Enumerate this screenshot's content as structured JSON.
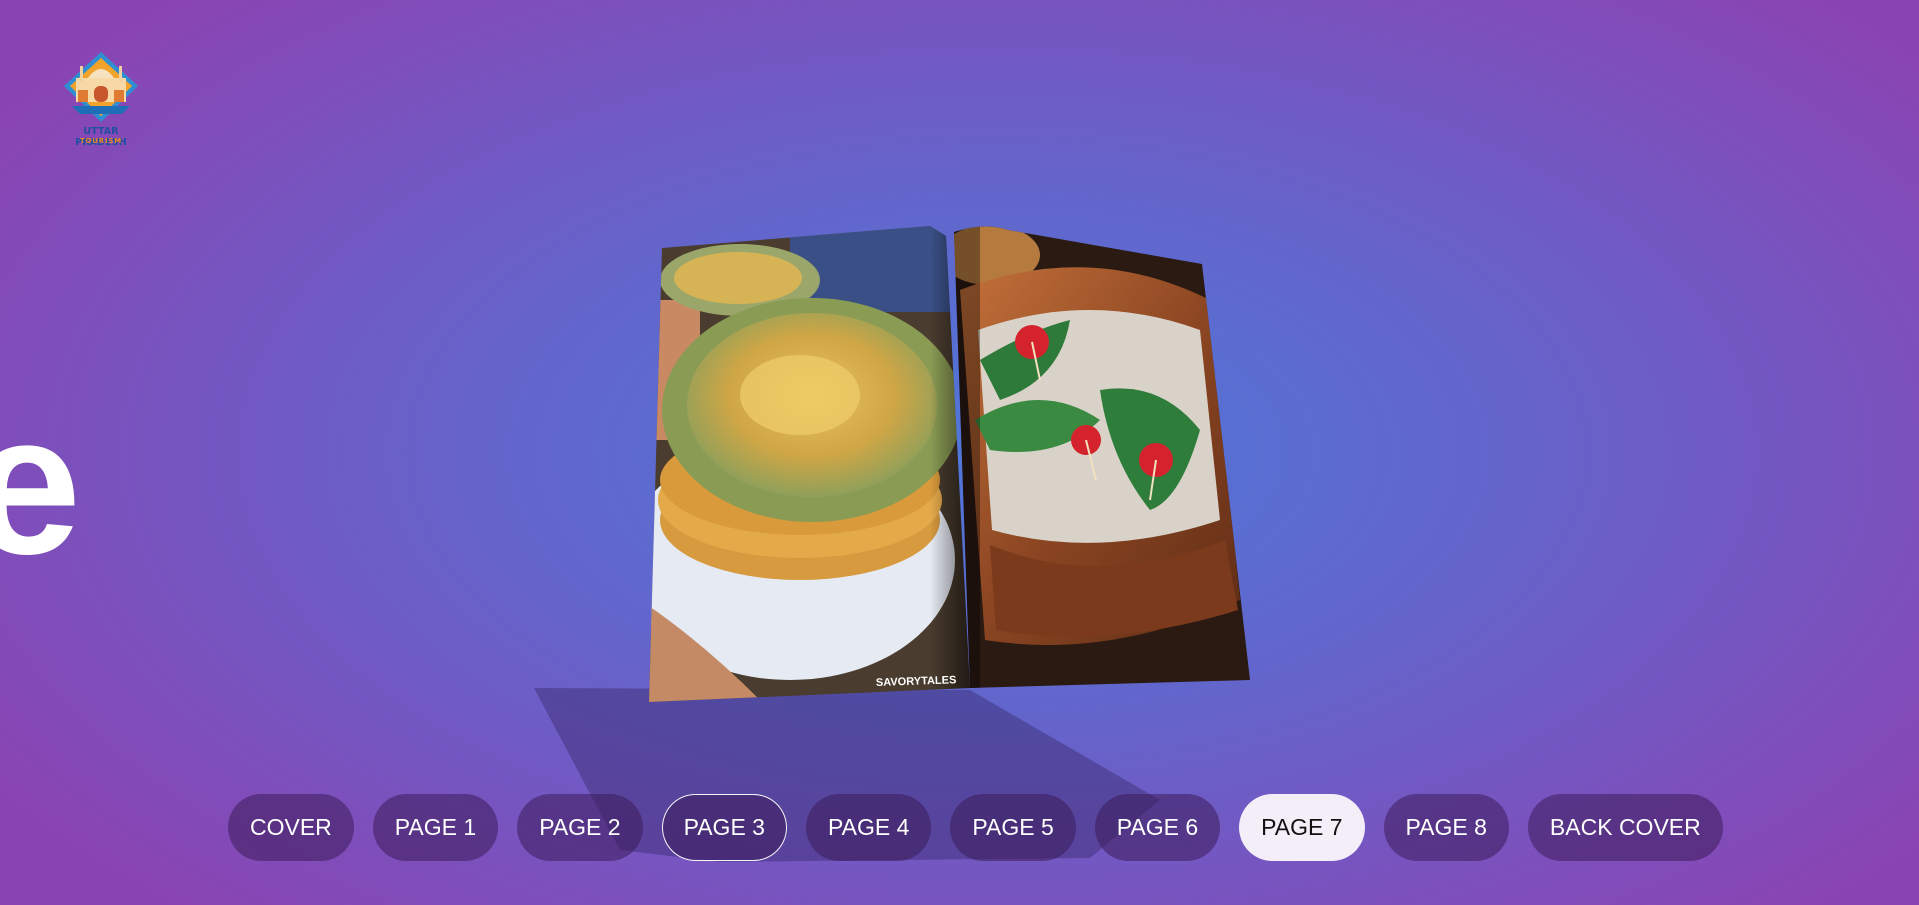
{
  "brand": {
    "name_line1": "UTTAR PRADESH",
    "name_line2": "TOURISM",
    "logo_icon": "uttar-pradesh-tourism-logo-icon"
  },
  "hero": {
    "partial_text": "e"
  },
  "book": {
    "left_page_image": "food-plate-image",
    "left_page_watermark": "SAVORYTALES",
    "right_page_image": "paan-bowl-image"
  },
  "pages_nav": {
    "items": [
      {
        "label": "COVER"
      },
      {
        "label": "PAGE 1"
      },
      {
        "label": "PAGE 2"
      },
      {
        "label": "PAGE 3"
      },
      {
        "label": "PAGE 4"
      },
      {
        "label": "PAGE 5"
      },
      {
        "label": "PAGE 6"
      },
      {
        "label": "PAGE 7"
      },
      {
        "label": "PAGE 8"
      },
      {
        "label": "BACK COVER"
      }
    ],
    "active_label": "PAGE 7",
    "outlined_label": "PAGE 3"
  },
  "colors": {
    "background_center": "#4f77d9",
    "background_edge": "#8a44b2",
    "pill_bg": "#3c1c5a",
    "pill_active_bg": "#f3eef8"
  }
}
